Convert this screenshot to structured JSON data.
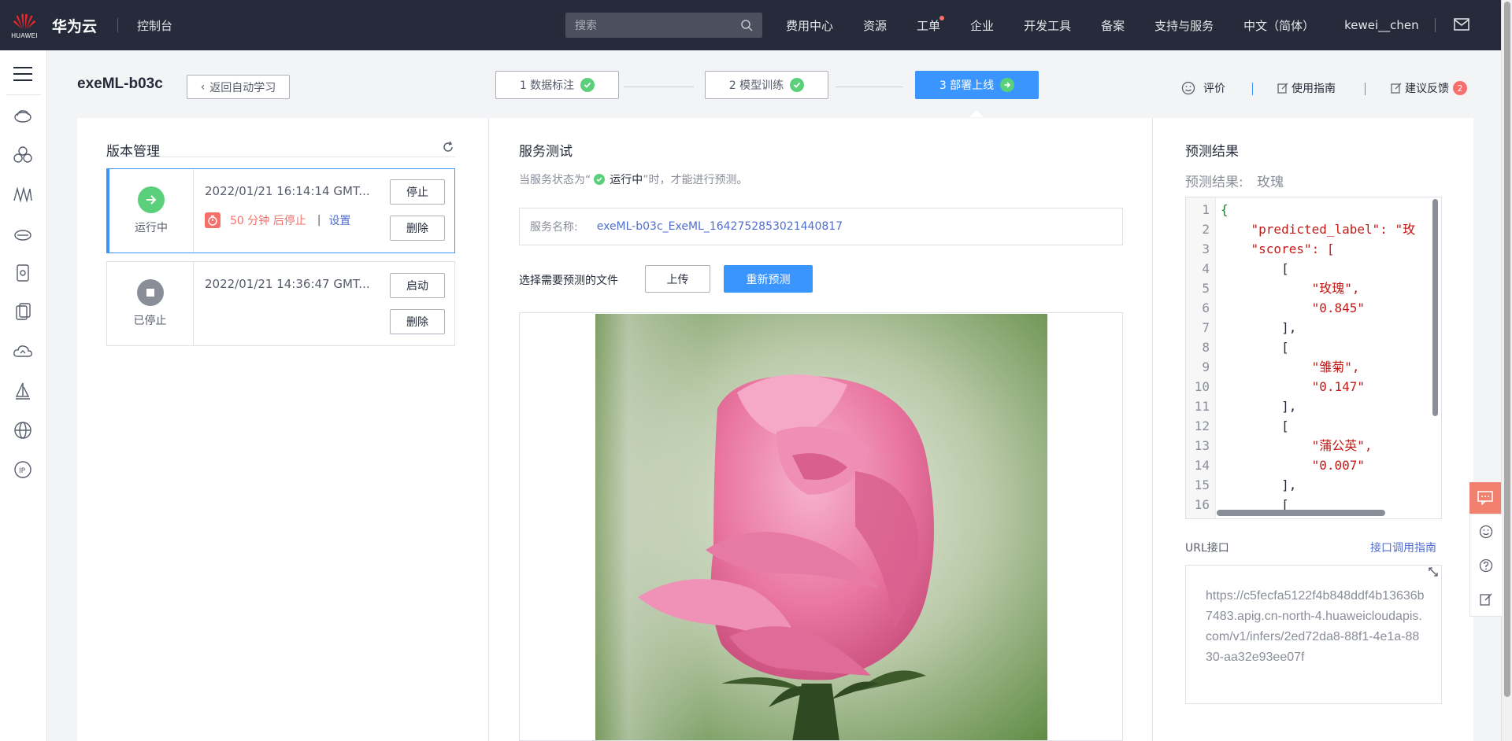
{
  "topbar": {
    "logo_text": "HUAWEI",
    "brand": "华为云",
    "console": "控制台",
    "search_placeholder": "搜索",
    "nav": [
      "费用中心",
      "资源",
      "工单",
      "企业",
      "开发工具",
      "备案",
      "支持与服务",
      "中文（简体）",
      "kewei__chen"
    ]
  },
  "page": {
    "title": "exeML-b03c",
    "back_label": "返回自动学习"
  },
  "steps": [
    {
      "label": "1 数据标注",
      "state": "done"
    },
    {
      "label": "2 模型训练",
      "state": "done"
    },
    {
      "label": "3 部署上线",
      "state": "active"
    }
  ],
  "header_actions": {
    "rate": "评价",
    "guide": "使用指南",
    "feedback": "建议反馈",
    "feedback_count": "2"
  },
  "versions": {
    "title": "版本管理",
    "items": [
      {
        "status": "运行中",
        "time": "2022/01/21 16:14:14 GMT...",
        "timer_text": "50 分钟 后停止",
        "timer_link": "设置",
        "btn1": "停止",
        "btn2": "删除"
      },
      {
        "status": "已停止",
        "time": "2022/01/21 14:36:47 GMT...",
        "btn1": "启动",
        "btn2": "删除"
      }
    ]
  },
  "service_test": {
    "title": "服务测试",
    "hint_prefix": "当服务状态为“",
    "hint_status": "运行中",
    "hint_suffix": "”时，才能进行预测。",
    "name_label": "服务名称:",
    "name_value": "exeML-b03c_ExeML_1642752853021440817",
    "file_label": "选择需要预测的文件",
    "upload": "上传",
    "repredict": "重新预测"
  },
  "prediction": {
    "title": "预测结果",
    "result_label": "预测结果:",
    "result_value": "玫瑰",
    "code_lines": [
      {
        "n": "1",
        "t": "{"
      },
      {
        "n": "2",
        "t": "    \"predicted_label\": \"玫"
      },
      {
        "n": "3",
        "t": "    \"scores\": ["
      },
      {
        "n": "4",
        "t": "        ["
      },
      {
        "n": "5",
        "t": "            \"玫瑰\","
      },
      {
        "n": "6",
        "t": "            \"0.845\""
      },
      {
        "n": "7",
        "t": "        ],"
      },
      {
        "n": "8",
        "t": "        ["
      },
      {
        "n": "9",
        "t": "            \"雏菊\","
      },
      {
        "n": "10",
        "t": "            \"0.147\""
      },
      {
        "n": "11",
        "t": "        ],"
      },
      {
        "n": "12",
        "t": "        ["
      },
      {
        "n": "13",
        "t": "            \"蒲公英\","
      },
      {
        "n": "14",
        "t": "            \"0.007\""
      },
      {
        "n": "15",
        "t": "        ],"
      },
      {
        "n": "16",
        "t": "        ["
      }
    ],
    "url_label": "URL接口",
    "url_guide": "接口调用指南",
    "url_value": "https://c5fecfa5122f4b848ddf4b13636b7483.apig.cn-north-4.huaweicloudapis.com/v1/infers/2ed72da8-88f1-4e1a-8830-aa32e93ee07f"
  },
  "colors": {
    "primary": "#3a95ff",
    "success": "#5ad07a",
    "danger": "#f66f6a",
    "topbar": "#252b3a"
  }
}
